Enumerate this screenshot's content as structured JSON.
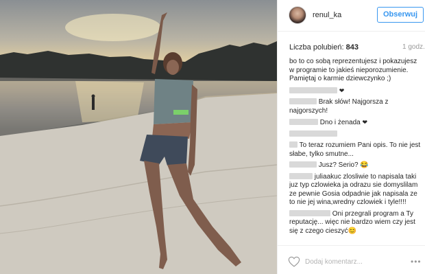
{
  "post": {
    "username": "renul_ka",
    "follow_label": "Obserwuj",
    "likes_label": "Liczba polubień:",
    "likes_count": "843",
    "time_ago": "1 godz."
  },
  "comments": [
    {
      "text": "bo to co sobą reprezentujesz i pokazujesz w programie to jakieś nieporozumienie. Pamiętaj o karmie dziewczynko ;)"
    },
    {
      "text": "Brak słów! Najgorsza z najgorszych!"
    },
    {
      "text": "Dno i żenada"
    },
    {
      "text": "To teraz rozumiem Pani opis. To nie jest słabe, tylko smutne..."
    },
    {
      "text": "Jusz? Serio? 😂"
    },
    {
      "text": "juliaakuc zlosliwie to napisala taki juz typ czlowieka ja odrazu sie domyslilam ze pewnie Gosia odpadnie jak napisala ze to nie jej wina,wredny czlowiek i tyle!!!!"
    },
    {
      "text": "Oni przegrali program a Ty reputację... więc nie bardzo wiem czy jest się z czego cieszyć😊"
    }
  ],
  "footer": {
    "comment_placeholder": "Dodaj komentarz...",
    "more_label": "•••"
  },
  "icons": {
    "like": "heart-outline-icon",
    "more": "more-options-icon"
  },
  "colors": {
    "accent": "#3897f0",
    "text": "#262626",
    "muted": "#999999",
    "border": "#efefef"
  }
}
